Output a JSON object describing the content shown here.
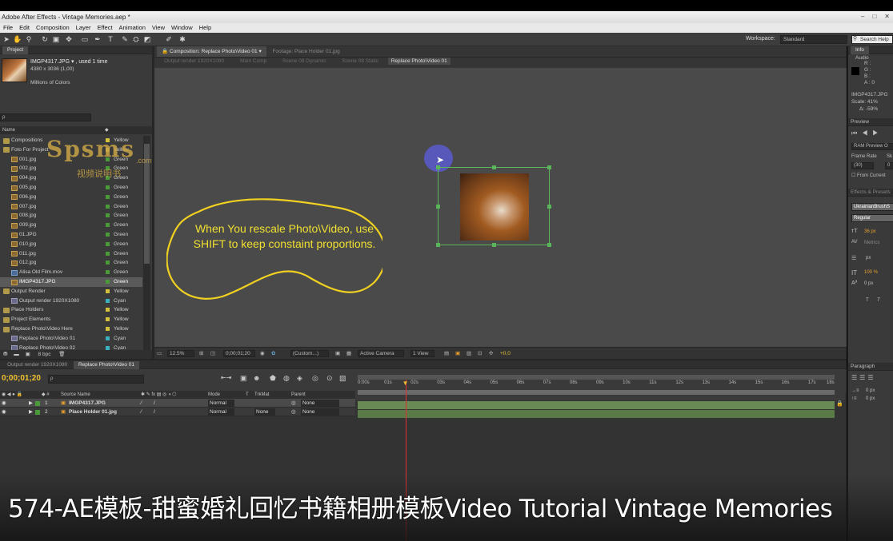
{
  "window": {
    "title": "Adobe After Effects - Vintage Memories.aep *",
    "controls": [
      "–",
      "□",
      "✕"
    ]
  },
  "menu": [
    "File",
    "Edit",
    "Composition",
    "Layer",
    "Effect",
    "Animation",
    "View",
    "Window",
    "Help"
  ],
  "workspace": {
    "label": "Workspace:",
    "value": "Standard",
    "search_placeholder": "Search Help"
  },
  "project": {
    "title": "Project",
    "preview_name": "IMGP4317.JPG ▾ , used 1 time",
    "preview_dims": "4380 x 3036 (1,00)",
    "preview_colors": "Millions of Colors",
    "search_value": "ρ",
    "col_name": "Name",
    "items": [
      {
        "name": "Compositions",
        "type": "folder",
        "indent": 0,
        "label": "Yellow",
        "color": "#d4c23c"
      },
      {
        "name": "Foto For Project",
        "type": "folder",
        "indent": 0,
        "label": "Yellow",
        "color": "#d4c23c"
      },
      {
        "name": "001.jpg",
        "type": "jpg",
        "indent": 1,
        "label": "Green",
        "color": "#4a9a3a"
      },
      {
        "name": "002.jpg",
        "type": "jpg",
        "indent": 1,
        "label": "Green",
        "color": "#4a9a3a"
      },
      {
        "name": "004.jpg",
        "type": "jpg",
        "indent": 1,
        "label": "Green",
        "color": "#4a9a3a"
      },
      {
        "name": "005.jpg",
        "type": "jpg",
        "indent": 1,
        "label": "Green",
        "color": "#4a9a3a"
      },
      {
        "name": "006.jpg",
        "type": "jpg",
        "indent": 1,
        "label": "Green",
        "color": "#4a9a3a"
      },
      {
        "name": "007.jpg",
        "type": "jpg",
        "indent": 1,
        "label": "Green",
        "color": "#4a9a3a"
      },
      {
        "name": "008.jpg",
        "type": "jpg",
        "indent": 1,
        "label": "Green",
        "color": "#4a9a3a"
      },
      {
        "name": "009.jpg",
        "type": "jpg",
        "indent": 1,
        "label": "Green",
        "color": "#4a9a3a"
      },
      {
        "name": "01.JPG",
        "type": "jpg",
        "indent": 1,
        "label": "Green",
        "color": "#4a9a3a"
      },
      {
        "name": "010.jpg",
        "type": "jpg",
        "indent": 1,
        "label": "Green",
        "color": "#4a9a3a"
      },
      {
        "name": "011.jpg",
        "type": "jpg",
        "indent": 1,
        "label": "Green",
        "color": "#4a9a3a"
      },
      {
        "name": "012.jpg",
        "type": "jpg",
        "indent": 1,
        "label": "Green",
        "color": "#4a9a3a"
      },
      {
        "name": "Alisa Old Film.mov",
        "type": "mov",
        "indent": 1,
        "label": "Green",
        "color": "#4a9a3a"
      },
      {
        "name": "IMGP4317.JPG",
        "type": "jpg",
        "indent": 1,
        "label": "Green",
        "color": "#4a9a3a",
        "selected": true
      },
      {
        "name": "Output Render",
        "type": "folder",
        "indent": 0,
        "label": "Yellow",
        "color": "#d4c23c"
      },
      {
        "name": "Output render 1920X1080",
        "type": "comp",
        "indent": 1,
        "label": "Cyan",
        "color": "#3ab0c0"
      },
      {
        "name": "Place Holders",
        "type": "folder",
        "indent": 0,
        "label": "Yellow",
        "color": "#d4c23c"
      },
      {
        "name": "Project Elements",
        "type": "folder",
        "indent": 0,
        "label": "Yellow",
        "color": "#d4c23c"
      },
      {
        "name": "Replace Photo\\Video Here",
        "type": "folder",
        "indent": 0,
        "label": "Yellow",
        "color": "#d4c23c"
      },
      {
        "name": "Replace Photo\\Video 01",
        "type": "comp",
        "indent": 1,
        "label": "Cyan",
        "color": "#3ab0c0"
      },
      {
        "name": "Replace Photo\\Video 02",
        "type": "comp",
        "indent": 1,
        "label": "Cyan",
        "color": "#3ab0c0"
      }
    ],
    "bpc": "8 bpc"
  },
  "watermark": {
    "brand": "Spsms",
    "domain": ".com",
    "sub": "视频说明书"
  },
  "composition": {
    "tab_comp": "Composition: Replace Photo\\Video 01",
    "tab_footage": "Footage: Place Holder 01.jpg",
    "flow": [
      "Output render 1920X1080",
      "Main Comp",
      "Scene 08 Dynamic",
      "Scene 08 Static",
      "Replace Photo\\Video 01"
    ],
    "callout": "When You rescale Photo\\Video, use SHIFT to keep constaint proportions."
  },
  "viewer": {
    "zoom": "12.5%",
    "timecode": "0;00;01;20",
    "resolution": "(Custom...)",
    "camera": "Active Camera",
    "view": "1 View",
    "exposure": "+0,0"
  },
  "timeline": {
    "tab_output": "Output render 1920X1080",
    "tab_replace": "Replace Photo\\Video 01",
    "timecode": "0;00;01;20",
    "search_placeholder": "ρ",
    "col_source": "Source Name",
    "col_mode": "Mode",
    "col_t": "T",
    "col_trkmat": "TrkMat",
    "col_parent": "Parent",
    "ruler": [
      "0:00s",
      "01s",
      "02s",
      "03s",
      "04s",
      "05s",
      "06s",
      "07s",
      "08s",
      "09s",
      "10s",
      "11s",
      "12s",
      "13s",
      "14s",
      "15s",
      "16s",
      "17s",
      "18s"
    ],
    "playhead_fraction": 0.1,
    "layers": [
      {
        "num": "1",
        "name": "IMGP4317.JPG",
        "mode": "Normal",
        "trkmat": "",
        "parent": "None",
        "selected": true
      },
      {
        "num": "2",
        "name": "Place Holder 01.jpg",
        "mode": "Normal",
        "trkmat": "None",
        "parent": "None",
        "selected": false
      }
    ]
  },
  "info": {
    "tab_info": "Info",
    "tab_audio": "Audio",
    "r": "R :",
    "g": "G :",
    "b": "B :",
    "a": "A : 0",
    "file": "IMGP4317.JPG",
    "scale": "Scale: 41%",
    "delta": "Δ: -59%"
  },
  "preview": {
    "title": "Preview",
    "ram": "RAM Preview O",
    "frame_rate_label": "Frame Rate",
    "skip_label": "Sk",
    "frame_rate_value": "(30)",
    "skip_value": "0",
    "from_current": "From Current"
  },
  "effects": {
    "title": "Effects & Presets",
    "font": "UkrainianBrushS",
    "style": "Regular",
    "size": "36 px",
    "tracking": "Metrics",
    "leading": "px",
    "vscale": "100 %",
    "baseline": "0 px",
    "t1": "T",
    "t2": "T"
  },
  "paragraph": {
    "title": "Paragraph",
    "indent1": "0 px",
    "indent2": "0 px"
  },
  "caption": "574-AE模板-甜蜜婚礼回忆书籍相册模板Video Tutorial Vintage Memories"
}
